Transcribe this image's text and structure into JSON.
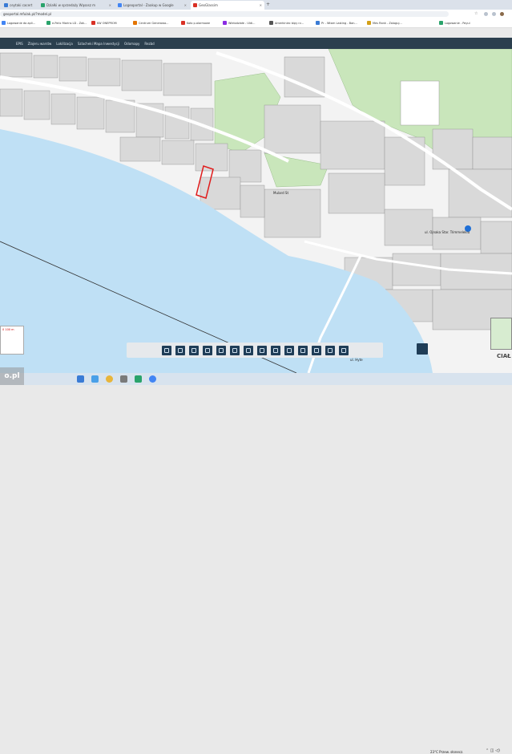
{
  "browser": {
    "tabs": [
      {
        "label": "ceytaki cacert",
        "active": false,
        "color": "#3a7bd5"
      },
      {
        "label": "Działki w sprzedaży Wąsosz m",
        "active": false,
        "color": "#2aa36b"
      },
      {
        "label": "Logeoportal - Zaakup w Google",
        "active": false,
        "color": "#4285f4"
      },
      {
        "label": "GeoGlassim",
        "active": true,
        "color": "#d93025"
      }
    ],
    "new_tab": "+",
    "url": "geoportal.mfulak.pl/?model.pl",
    "bookmarks": [
      {
        "label": "Logowanie do apli...",
        "color": "#4285f4"
      },
      {
        "label": "e-Pańc Marins LD - Zak...",
        "color": "#2aa36b"
      },
      {
        "label": "KW ONEPROM",
        "color": "#d93025"
      },
      {
        "label": "Centrum Generowa...",
        "color": "#e37400"
      },
      {
        "label": "Koło p.alarmowe",
        "color": "#d93025"
      },
      {
        "label": "Wielodziałe - Uldi...",
        "color": "#8a2be2"
      },
      {
        "label": "Amerkiniec bipy rz...",
        "color": "#555555"
      },
      {
        "label": "Pr - Wtam Lasting - Ban...",
        "color": "#3a7bd5"
      },
      {
        "label": "Mes Rank - Zaloguj...",
        "color": "#d4a017"
      },
      {
        "label": "Logowanie - Payui",
        "color": "#2aa36b"
      }
    ]
  },
  "app": {
    "menu": [
      "EPIS",
      "Zlajeru warstw",
      "Lokillzacja",
      "Szlacheki Mapa Inwestycji",
      "Odomapy",
      "Rezbd"
    ]
  },
  "map": {
    "labels": [
      {
        "text": "Mulard St"
      },
      {
        "text": "ul. Ojnaka Star. Trimmelekiu"
      },
      {
        "text": "ul. Hyte"
      }
    ],
    "scale_text": "0 100 m",
    "corner_text": "CIAŁ",
    "toolbar_tools": [
      "layers-icon",
      "print-icon",
      "measure-icon",
      "zoom-in-icon",
      "zoom-out-icon",
      "pan-icon",
      "extent-icon",
      "info-icon",
      "select-icon",
      "export-icon",
      "draw-icon",
      "ruler-icon",
      "share-icon",
      "settings-icon"
    ],
    "colors": {
      "water": "#bfe0f5",
      "forest": "#c9e6bb",
      "parcel": "#d9d9d9",
      "highlight": "#e01b1b"
    }
  },
  "taskbar": {
    "watermark": "o.pl",
    "weather": "23°C  Przew. słonecz.",
    "tray": "⌃ ◫ ◁)"
  }
}
